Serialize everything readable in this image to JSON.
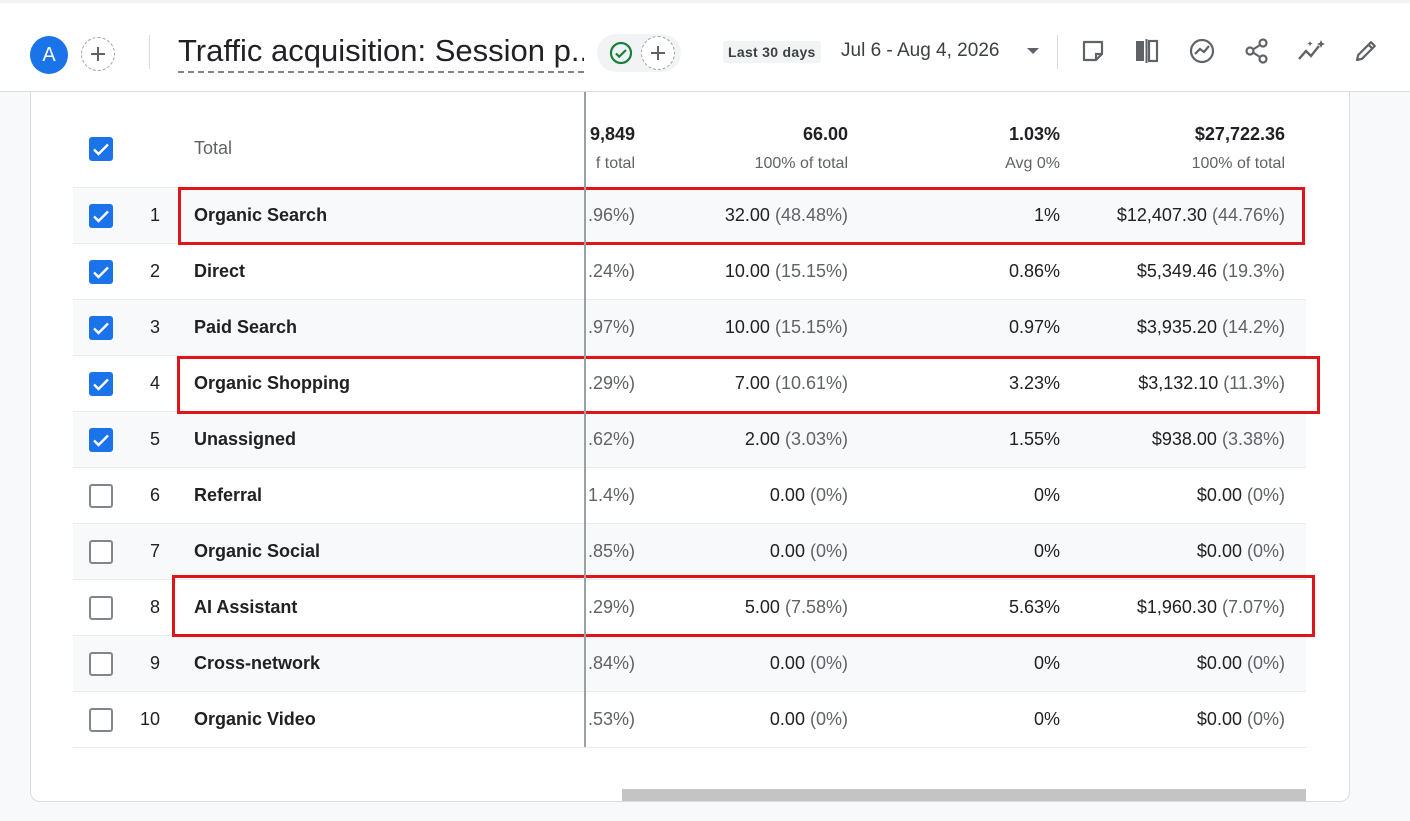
{
  "header": {
    "avatar_letter": "A",
    "title": "Traffic acquisition: Session p...",
    "range_label": "Last 30 days",
    "date_range": "Jul 6 - Aug 4, 2026",
    "icons": [
      "add-comparison-icon",
      "check-circle-icon",
      "add-icon",
      "note-icon",
      "compare-columns-icon",
      "insights-icon",
      "share-icon",
      "sparkle-trend-icon",
      "edit-icon"
    ]
  },
  "total": {
    "label": "Total",
    "col1": "9,849",
    "col1_sub": "f total",
    "col2": "66.00",
    "col2_sub": "100% of total",
    "col3": "1.03%",
    "col3_sub": "Avg 0%",
    "col4": "$27,722.36",
    "col4_sub": "100% of total"
  },
  "rows": [
    {
      "rank": "1",
      "name": "Organic Search",
      "c1": ".96%)",
      "c2": "32.00",
      "c2p": "(48.48%)",
      "c3": "1%",
      "c4": "$12,407.30",
      "c4p": "(44.76%)",
      "checked": true,
      "highlight": true
    },
    {
      "rank": "2",
      "name": "Direct",
      "c1": ".24%)",
      "c2": "10.00",
      "c2p": "(15.15%)",
      "c3": "0.86%",
      "c4": "$5,349.46",
      "c4p": "(19.3%)",
      "checked": true,
      "highlight": false
    },
    {
      "rank": "3",
      "name": "Paid Search",
      "c1": ".97%)",
      "c2": "10.00",
      "c2p": "(15.15%)",
      "c3": "0.97%",
      "c4": "$3,935.20",
      "c4p": "(14.2%)",
      "checked": true,
      "highlight": false
    },
    {
      "rank": "4",
      "name": "Organic Shopping",
      "c1": ".29%)",
      "c2": "7.00",
      "c2p": "(10.61%)",
      "c3": "3.23%",
      "c4": "$3,132.10",
      "c4p": "(11.3%)",
      "checked": true,
      "highlight": true
    },
    {
      "rank": "5",
      "name": "Unassigned",
      "c1": ".62%)",
      "c2": "2.00",
      "c2p": "(3.03%)",
      "c3": "1.55%",
      "c4": "$938.00",
      "c4p": "(3.38%)",
      "checked": true,
      "highlight": false
    },
    {
      "rank": "6",
      "name": "Referral",
      "c1": "1.4%)",
      "c2": "0.00",
      "c2p": "(0%)",
      "c3": "0%",
      "c4": "$0.00",
      "c4p": "(0%)",
      "checked": false,
      "highlight": false
    },
    {
      "rank": "7",
      "name": "Organic Social",
      "c1": ".85%)",
      "c2": "0.00",
      "c2p": "(0%)",
      "c3": "0%",
      "c4": "$0.00",
      "c4p": "(0%)",
      "checked": false,
      "highlight": false
    },
    {
      "rank": "8",
      "name": "AI Assistant",
      "c1": ".29%)",
      "c2": "5.00",
      "c2p": "(7.58%)",
      "c3": "5.63%",
      "c4": "$1,960.30",
      "c4p": "(7.07%)",
      "checked": false,
      "highlight": true
    },
    {
      "rank": "9",
      "name": "Cross-network",
      "c1": ".84%)",
      "c2": "0.00",
      "c2p": "(0%)",
      "c3": "0%",
      "c4": "$0.00",
      "c4p": "(0%)",
      "checked": false,
      "highlight": false
    },
    {
      "rank": "10",
      "name": "Organic Video",
      "c1": ".53%)",
      "c2": "0.00",
      "c2p": "(0%)",
      "c3": "0%",
      "c4": "$0.00",
      "c4p": "(0%)",
      "checked": false,
      "highlight": false
    }
  ]
}
